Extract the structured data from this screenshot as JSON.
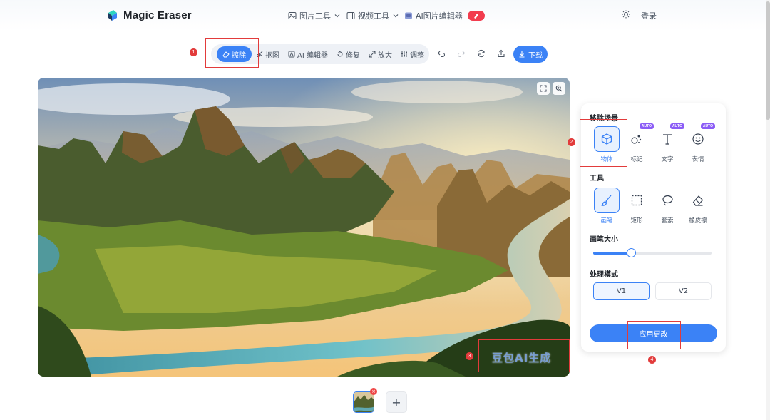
{
  "header": {
    "app_name": "Magic Eraser",
    "nav": [
      {
        "label": "图片工具",
        "icon": "image-icon",
        "has_dropdown": true
      },
      {
        "label": "视频工具",
        "icon": "video-icon",
        "has_dropdown": true
      },
      {
        "label": "AI图片编辑器",
        "icon": "ai-editor-icon",
        "badge_icon": "sparkle-icon"
      }
    ],
    "theme_icon": "sun-icon",
    "login_label": "登录"
  },
  "toolbar": {
    "tools": [
      {
        "label": "擦除",
        "icon": "eraser-icon",
        "active": true
      },
      {
        "label": "抠图",
        "icon": "cutout-icon",
        "active": false
      },
      {
        "label": "AI 编辑器",
        "icon": "ai-edit-icon",
        "active": false
      },
      {
        "label": "修复",
        "icon": "restore-icon",
        "active": false
      },
      {
        "label": "放大",
        "icon": "expand-icon",
        "active": false
      },
      {
        "label": "调整",
        "icon": "adjust-icon",
        "active": false
      }
    ],
    "actions": [
      "undo-icon",
      "redo-icon",
      "refresh-icon",
      "share-icon"
    ],
    "download_label": "下载"
  },
  "canvas": {
    "tools": [
      "fullscreen-icon",
      "zoom-icon"
    ],
    "watermark": "豆包AI生成"
  },
  "panel": {
    "scene_title": "移除场景",
    "scenes": [
      {
        "label": "物体",
        "icon": "cube-icon",
        "selected": true,
        "auto": false
      },
      {
        "label": "标记",
        "icon": "marker-icon",
        "selected": false,
        "auto": true
      },
      {
        "label": "文字",
        "icon": "text-icon",
        "selected": false,
        "auto": true
      },
      {
        "label": "表情",
        "icon": "emoji-icon",
        "selected": false,
        "auto": true
      }
    ],
    "auto_tag": "AUTO",
    "tools_title": "工具",
    "tools": [
      {
        "label": "画笔",
        "icon": "brush-icon",
        "selected": true
      },
      {
        "label": "矩形",
        "icon": "rectangle-icon",
        "selected": false
      },
      {
        "label": "套索",
        "icon": "lasso-icon",
        "selected": false
      },
      {
        "label": "橡皮擦",
        "icon": "eraser-tool-icon",
        "selected": false
      }
    ],
    "brush_title": "画笔大小",
    "brush_level": 0.32,
    "mode_title": "处理模式",
    "modes": [
      {
        "label": "V1",
        "selected": true
      },
      {
        "label": "V2",
        "selected": false
      }
    ],
    "apply_label": "应用更改"
  },
  "annotations": [
    "1",
    "2",
    "3",
    "4"
  ],
  "thumbnails": {
    "close": "×",
    "add": "+"
  },
  "colors": {
    "accent": "#3b82f6",
    "annotation": "#e23b3b",
    "auto_tag": "#8b5cf6"
  }
}
